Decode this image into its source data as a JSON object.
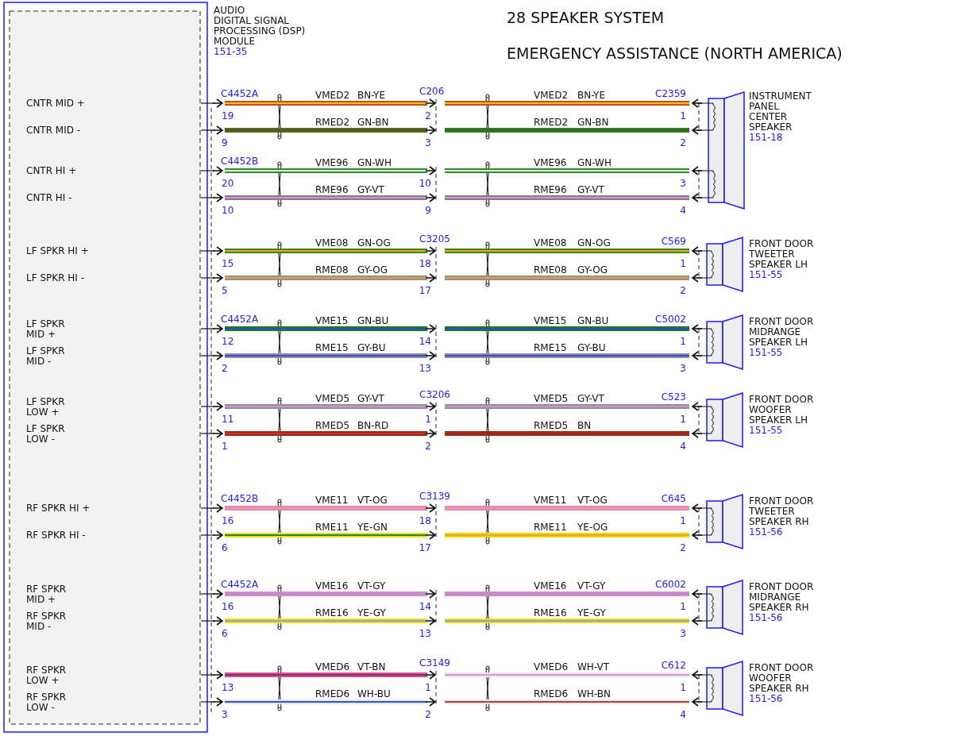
{
  "module": {
    "name_lines": [
      "AUDIO",
      "DIGITAL SIGNAL",
      "PROCESSING (DSP)",
      "MODULE"
    ],
    "ref": "151-35"
  },
  "title": "28 SPEAKER SYSTEM",
  "subtitle": "EMERGENCY ASSISTANCE (NORTH AMERICA)",
  "speakers": [
    {
      "name_lines": [
        "INSTRUMENT",
        "PANEL",
        "CENTER",
        "SPEAKER"
      ],
      "ref": "151-18",
      "groups": [
        {
          "left_connector": "C4452A",
          "mid_connector": "C206",
          "right_connector": "C2359",
          "wires": [
            {
              "module_pin": [
                "CNTR MID +"
              ],
              "left_pin": "19",
              "mid_pin": "2",
              "right_pin": "1",
              "left": {
                "circuit": "VMED2",
                "code": "BN-YE",
                "color": "#c0501a",
                "stripe": {
                  "color": "#f0c020"
                }
              },
              "right": {
                "circuit": "VMED2",
                "code": "BN-YE",
                "color": "#c0501a",
                "stripe": {
                  "color": "#f0c020"
                }
              }
            },
            {
              "module_pin": [
                "CNTR MID -"
              ],
              "left_pin": "9",
              "mid_pin": "3",
              "right_pin": "2",
              "left": {
                "circuit": "RMED2",
                "code": "GN-BN",
                "color": "#2e7d1e",
                "stripe": {
                  "color": "#a03018"
                }
              },
              "right": {
                "circuit": "RMED2",
                "code": "GN-BN",
                "color": "#2e7d1e",
                "stripe": {
                  "color": "#3a6a18"
                }
              }
            }
          ]
        },
        {
          "left_connector": "C4452B",
          "wires": [
            {
              "module_pin": [
                "CNTR HI +"
              ],
              "left_pin": "20",
              "mid_pin": "10",
              "right_pin": "3",
              "left": {
                "circuit": "VME96",
                "code": "GN-WH",
                "color": "#2e8b2e",
                "stripe": {
                  "color": "#e8ffe8"
                }
              },
              "right": {
                "circuit": "VME96",
                "code": "GN-WH",
                "color": "#2e8b2e",
                "stripe": {
                  "color": "#e8ffe8"
                }
              }
            },
            {
              "module_pin": [
                "CNTR HI -"
              ],
              "left_pin": "10",
              "mid_pin": "9",
              "right_pin": "4",
              "left": {
                "circuit": "RME96",
                "code": "GY-VT",
                "color": "#808080",
                "stripe": {
                  "color": "#d890d8"
                }
              },
              "right": {
                "circuit": "RME96",
                "code": "GY-VT",
                "color": "#808080",
                "stripe": {
                  "color": "#d890d8"
                }
              }
            }
          ]
        }
      ]
    },
    {
      "name_lines": [
        "FRONT DOOR",
        "TWEETER",
        "SPEAKER LH"
      ],
      "ref": "151-55",
      "groups": [
        {
          "mid_connector": "C3205",
          "right_connector": "C569",
          "wires": [
            {
              "module_pin": [
                "LF SPKR HI +"
              ],
              "left_pin": "15",
              "mid_pin": "18",
              "right_pin": "1",
              "left": {
                "circuit": "VME08",
                "code": "GN-OG",
                "color": "#3a8a1a",
                "stripe": {
                  "color": "#f0a030"
                }
              },
              "right": {
                "circuit": "VME08",
                "code": "GN-OG",
                "color": "#3a8a1a",
                "stripe": {
                  "color": "#f0a030"
                }
              }
            },
            {
              "module_pin": [
                "LF SPKR HI -"
              ],
              "left_pin": "5",
              "mid_pin": "17",
              "right_pin": "2",
              "left": {
                "circuit": "RME08",
                "code": "GY-OG",
                "color": "#909090",
                "stripe": {
                  "color": "#f0a030"
                }
              },
              "right": {
                "circuit": "RME08",
                "code": "GY-OG",
                "color": "#909090",
                "stripe": {
                  "color": "#f0a030"
                }
              }
            }
          ]
        }
      ]
    },
    {
      "name_lines": [
        "FRONT DOOR",
        "MIDRANGE",
        "SPEAKER LH"
      ],
      "ref": "151-55",
      "groups": [
        {
          "left_connector": "C4452A",
          "right_connector": "C5002",
          "wires": [
            {
              "module_pin": [
                "LF SPKR",
                "MID +"
              ],
              "left_pin": "12",
              "mid_pin": "14",
              "right_pin": "1",
              "left": {
                "circuit": "VME15",
                "code": "GN-BU",
                "color": "#1e7a1e",
                "stripe": {
                  "color": "#2050d0"
                }
              },
              "right": {
                "circuit": "VME15",
                "code": "GN-BU",
                "color": "#1e7a1e",
                "stripe": {
                  "color": "#2050d0"
                }
              }
            },
            {
              "module_pin": [
                "LF SPKR",
                "MID -"
              ],
              "left_pin": "2",
              "mid_pin": "13",
              "right_pin": "3",
              "left": {
                "circuit": "RME15",
                "code": "GY-BU",
                "color": "#909090",
                "stripe": {
                  "color": "#3050e0"
                }
              },
              "right": {
                "circuit": "RME15",
                "code": "GY-BU",
                "color": "#909090",
                "stripe": {
                  "color": "#3050e0"
                }
              }
            }
          ]
        }
      ]
    },
    {
      "name_lines": [
        "FRONT DOOR",
        "WOOFER",
        "SPEAKER LH"
      ],
      "ref": "151-55",
      "groups": [
        {
          "mid_connector": "C3206",
          "right_connector": "C523",
          "wires": [
            {
              "module_pin": [
                "LF SPKR",
                "LOW +"
              ],
              "left_pin": "11",
              "mid_pin": "1",
              "right_pin": "1",
              "left": {
                "circuit": "VMED5",
                "code": "GY-VT",
                "color": "#909090",
                "stripe": {
                  "color": "#d890d8"
                }
              },
              "right": {
                "circuit": "VMED5",
                "code": "GY-VT",
                "color": "#909090",
                "stripe": {
                  "color": "#d890d8"
                }
              }
            },
            {
              "module_pin": [
                "LF SPKR",
                "LOW -"
              ],
              "left_pin": "1",
              "mid_pin": "2",
              "right_pin": "4",
              "left": {
                "circuit": "RMED5",
                "code": "BN-RD",
                "color": "#a02a1a",
                "stripe": {
                  "color": "#d03020"
                }
              },
              "right": {
                "circuit": "RMED5",
                "code": "BN",
                "color": "#a02a1a"
              }
            }
          ]
        }
      ]
    },
    {
      "name_lines": [
        "FRONT DOOR",
        "TWEETER",
        "SPEAKER RH"
      ],
      "ref": "151-56",
      "groups": [
        {
          "left_connector": "C4452B",
          "mid_connector": "C3139",
          "right_connector": "C645",
          "wires": [
            {
              "module_pin": [
                "RF SPKR HI +"
              ],
              "left_pin": "16",
              "mid_pin": "18",
              "right_pin": "1",
              "left": {
                "circuit": "VME11",
                "code": "VT-OG",
                "color": "#e080d0",
                "stripe": {
                  "color": "#f4a070"
                }
              },
              "right": {
                "circuit": "VME11",
                "code": "VT-OG",
                "color": "#e080d0",
                "stripe": {
                  "color": "#f4a070"
                }
              }
            },
            {
              "module_pin": [
                "RF SPKR HI -"
              ],
              "left_pin": "6",
              "mid_pin": "17",
              "right_pin": "2",
              "left": {
                "circuit": "RME11",
                "code": "YE-GN",
                "color": "#e8e020",
                "stripe": {
                  "color": "#2a8a2a"
                }
              },
              "right": {
                "circuit": "RME11",
                "code": "YE-OG",
                "color": "#f0d800",
                "stripe": {
                  "color": "#f0a030"
                }
              }
            }
          ]
        }
      ]
    },
    {
      "name_lines": [
        "FRONT DOOR",
        "MIDRANGE",
        "SPEAKER RH"
      ],
      "ref": "151-56",
      "groups": [
        {
          "left_connector": "C4452A",
          "right_connector": "C6002",
          "wires": [
            {
              "module_pin": [
                "RF SPKR",
                "MID +"
              ],
              "left_pin": "16",
              "mid_pin": "14",
              "right_pin": "1",
              "left": {
                "circuit": "VME16",
                "code": "VT-GY",
                "color": "#e080e0",
                "stripe": {
                  "color": "#a0a0a0"
                }
              },
              "right": {
                "circuit": "VME16",
                "code": "VT-GY",
                "color": "#e080e0",
                "stripe": {
                  "color": "#a0a0a0"
                }
              }
            },
            {
              "module_pin": [
                "RF SPKR",
                "MID -"
              ],
              "left_pin": "6",
              "mid_pin": "13",
              "right_pin": "3",
              "left": {
                "circuit": "RME16",
                "code": "YE-GY",
                "color": "#e8e020",
                "stripe": {
                  "color": "#a0a0a0"
                }
              },
              "right": {
                "circuit": "RME16",
                "code": "YE-GY",
                "color": "#e8e020",
                "stripe": {
                  "color": "#a0a0a0"
                }
              }
            }
          ]
        }
      ]
    },
    {
      "name_lines": [
        "FRONT DOOR",
        "WOOFER",
        "SPEAKER RH"
      ],
      "ref": "151-56",
      "groups": [
        {
          "mid_connector": "C3149",
          "right_connector": "C612",
          "wires": [
            {
              "module_pin": [
                "RF SPKR",
                "LOW +"
              ],
              "left_pin": "13",
              "mid_pin": "1",
              "right_pin": "1",
              "left": {
                "circuit": "VMED6",
                "code": "VT-BN",
                "color": "#d050b0",
                "stripe": {
                  "color": "#a03030"
                }
              },
              "right": {
                "circuit": "VMED6",
                "code": "WH-VT",
                "color": "#e8e8e8",
                "stripe": {
                  "color": "#e090e0"
                }
              }
            },
            {
              "module_pin": [
                "RF SPKR",
                "LOW -"
              ],
              "left_pin": "3",
              "mid_pin": "2",
              "right_pin": "4",
              "left": {
                "circuit": "RMED6",
                "code": "WH-BU",
                "color": "#e8e8e8",
                "stripe": {
                  "color": "#3050e0"
                }
              },
              "right": {
                "circuit": "RMED6",
                "code": "WH-BN",
                "color": "#e8e8e8",
                "stripe": {
                  "color": "#b04040"
                }
              }
            }
          ]
        }
      ]
    }
  ]
}
